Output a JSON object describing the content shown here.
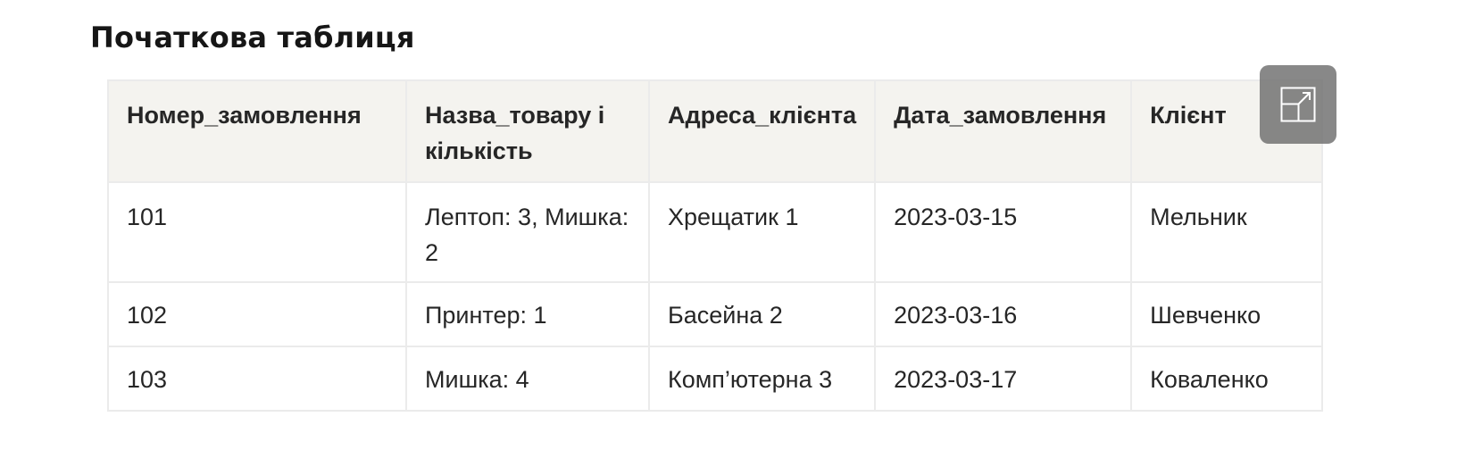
{
  "page": {
    "title": "Початкова таблиця"
  },
  "table": {
    "headers": [
      "Номер_замовлення",
      "Назва_товару і кількість",
      "Адреса_клієнта",
      "Дата_замовлення",
      "Клієнт"
    ],
    "rows": [
      [
        "101",
        "Лептоп: 3, Мишка: 2",
        "Хрещатик 1",
        "2023-03-15",
        "Мельник"
      ],
      [
        "102",
        "Принтер: 1",
        "Басейна 2",
        "2023-03-16",
        "Шевченко"
      ],
      [
        "103",
        "Мишка: 4",
        "Комп’ютерна 3",
        "2023-03-17",
        "Коваленко"
      ]
    ]
  },
  "icons": {
    "expand": "expand-icon"
  },
  "colors": {
    "header_bg": "#f4f3ef",
    "border": "#ebebeb",
    "button_bg": "#6e6e6e"
  }
}
